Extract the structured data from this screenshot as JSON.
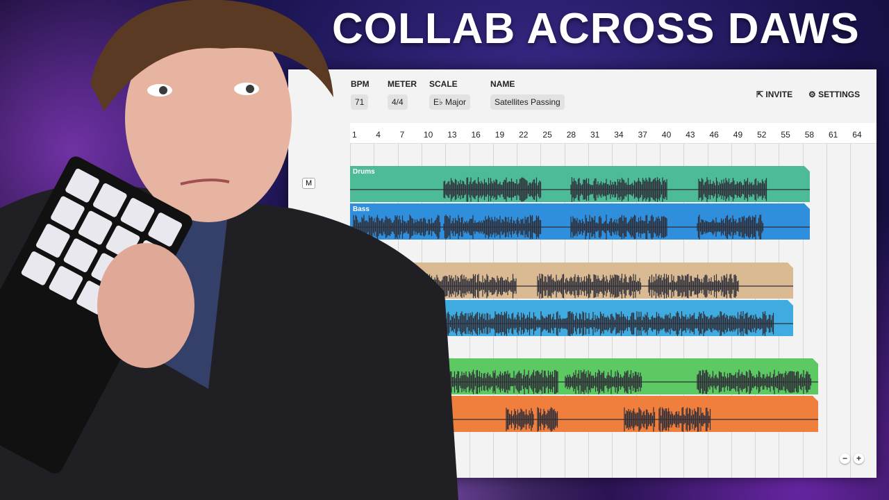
{
  "thumbnail_title": "COLLAB ACROSS DAWS",
  "header": {
    "bpm": {
      "label": "BPM",
      "value": "71"
    },
    "meter": {
      "label": "METER",
      "value": "4/4"
    },
    "scale": {
      "label": "SCALE",
      "value": "E♭ Major"
    },
    "name": {
      "label": "NAME",
      "value": "Satellites Passing"
    },
    "invite_label": "INVITE",
    "settings_label": "SETTINGS"
  },
  "ruler": [
    "1",
    "4",
    "7",
    "10",
    "13",
    "16",
    "19",
    "22",
    "25",
    "28",
    "31",
    "34",
    "37",
    "40",
    "43",
    "46",
    "49",
    "52",
    "55",
    "58",
    "61",
    "64"
  ],
  "track_button": "M",
  "tracks": [
    {
      "name": "Drums",
      "color": "#4dba98"
    },
    {
      "name": "Bass",
      "color": "#2f8fdc"
    },
    {
      "name": "",
      "color": "#d9ba92"
    },
    {
      "name": "",
      "color": "#40abe0"
    },
    {
      "name": "",
      "color": "#5dc963"
    },
    {
      "name": "",
      "color": "#f07e3c"
    }
  ],
  "zoom": {
    "out": "−",
    "in": "+"
  }
}
